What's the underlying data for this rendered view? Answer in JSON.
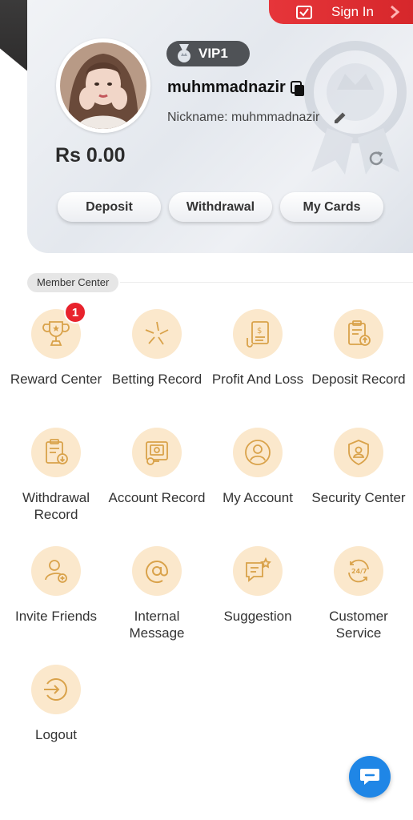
{
  "header": {
    "signin_label": "Sign In",
    "vip_label": "VIP1",
    "username": "muhmmadnazir",
    "nickname": "Nickname: muhmmadnazir",
    "balance": "Rs 0.00"
  },
  "actions": [
    {
      "label": "Deposit"
    },
    {
      "label": "Withdrawal"
    },
    {
      "label": "My Cards"
    }
  ],
  "member_center": {
    "title": "Member Center",
    "items": [
      {
        "label": "Reward Center",
        "icon": "trophy-icon",
        "badge": "1"
      },
      {
        "label": "Betting Record",
        "icon": "betting-star-icon"
      },
      {
        "label": "Profit And Loss",
        "icon": "receipt-icon"
      },
      {
        "label": "Deposit Record",
        "icon": "clipboard-upload-icon"
      },
      {
        "label": "Withdrawal Record",
        "icon": "clipboard-download-icon"
      },
      {
        "label": "Account Record",
        "icon": "account-record-icon"
      },
      {
        "label": "My Account",
        "icon": "user-icon"
      },
      {
        "label": "Security Center",
        "icon": "shield-user-icon"
      },
      {
        "label": "Invite Friends",
        "icon": "add-user-icon"
      },
      {
        "label": "Internal Message",
        "icon": "at-sign-icon"
      },
      {
        "label": "Suggestion",
        "icon": "feedback-icon"
      },
      {
        "label": "Customer Service",
        "icon": "support-24-7-icon"
      },
      {
        "label": "Logout",
        "icon": "logout-icon"
      }
    ]
  },
  "colors": {
    "accent_red": "#e6353a",
    "icon_bg": "#fbe8cc",
    "icon_stroke": "#d9a24a",
    "chat_blue": "#1f86e6"
  }
}
